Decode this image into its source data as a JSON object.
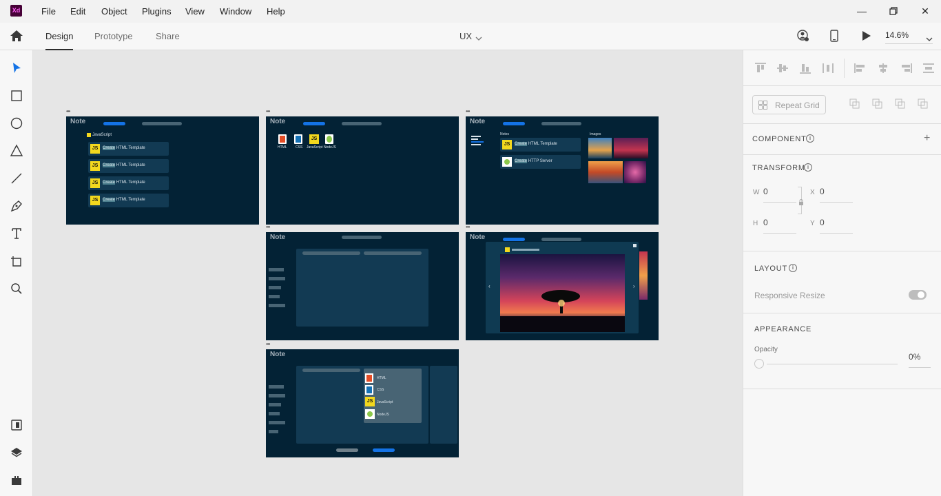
{
  "app": {
    "logo": "Xd"
  },
  "menu": [
    "File",
    "Edit",
    "Object",
    "Plugins",
    "View",
    "Window",
    "Help"
  ],
  "toolbar": {
    "tabs": [
      "Design",
      "Prototype",
      "Share"
    ],
    "doc_title": "UX",
    "zoom": "14.6%"
  },
  "artboards": {
    "logo": "Note",
    "ab1": {
      "section": "JavaScript",
      "cards": [
        "HTML Template",
        "HTML Template",
        "HTML Template",
        "HTML Template"
      ],
      "create": "Create",
      "js": "JS"
    },
    "ab2": {
      "icons": [
        "HTML",
        "CSS",
        "JavaScript",
        "NodeJS"
      ]
    },
    "ab3": {
      "notes_label": "Notes",
      "images_label": "Images",
      "cards": [
        "HTML Template",
        "HTTP Server"
      ],
      "create": "Create"
    },
    "ab6": {
      "options": [
        "HTML",
        "CSS",
        "JavaScript",
        "NodeJS"
      ]
    }
  },
  "rightpanel": {
    "repeat_grid": "Repeat Grid",
    "component": "COMPONENT",
    "transform": "TRANSFORM",
    "w_label": "W",
    "w_value": "0",
    "x_label": "X",
    "x_value": "0",
    "h_label": "H",
    "h_value": "0",
    "y_label": "Y",
    "y_value": "0",
    "layout": "LAYOUT",
    "responsive_resize": "Responsive Resize",
    "appearance": "APPEARANCE",
    "opacity_label": "Opacity",
    "opacity_value": "0%"
  },
  "colors": {
    "artboard_bg": "#032235",
    "card_bg": "#123a53",
    "accent_blue": "#1473e6",
    "js_yellow": "#f3d81e"
  }
}
